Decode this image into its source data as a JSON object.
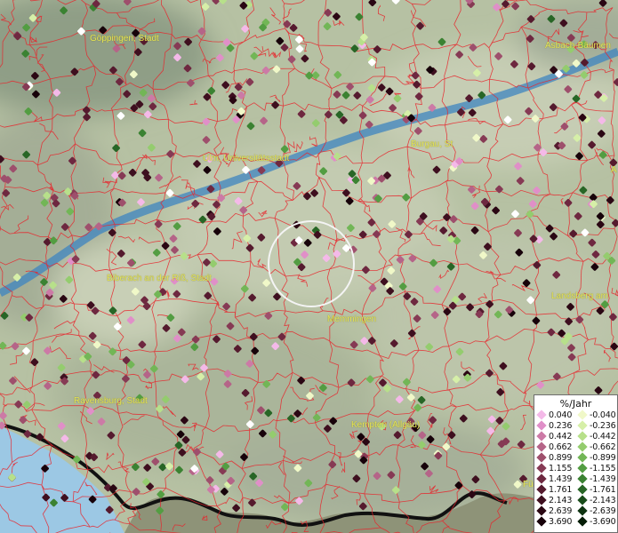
{
  "map": {
    "labels": {
      "goeppingen": "Göppingen, Stadt",
      "asbach": "Asbach-Bäumen",
      "ulm": "Ulm, Universitätsstadt",
      "burgau": "Burgau, St",
      "a_edge": "A",
      "biberach": "Biberach an der Riß, Stadt",
      "memmingen": "Memmingen",
      "landsberg": "Landsberg am",
      "ravensburg": "Ravensburg, Stadt",
      "kempten": "Kempten (Allgäu)",
      "fu_edge": "Fü"
    }
  },
  "legend": {
    "title": "%/Jahr",
    "positive": [
      {
        "label": "0.040",
        "color": "#f4b9e8"
      },
      {
        "label": "0.236",
        "color": "#e08fc8"
      },
      {
        "label": "0.442",
        "color": "#cc7aa6"
      },
      {
        "label": "0.662",
        "color": "#b56488"
      },
      {
        "label": "0.899",
        "color": "#9e4f6c"
      },
      {
        "label": "1.155",
        "color": "#863a54"
      },
      {
        "label": "1.439",
        "color": "#6e2840"
      },
      {
        "label": "1.761",
        "color": "#551a2e"
      },
      {
        "label": "2.143",
        "color": "#3e0f1f"
      },
      {
        "label": "2.639",
        "color": "#2a0713"
      },
      {
        "label": "3.690",
        "color": "#17020a"
      }
    ],
    "negative": [
      {
        "label": "-0.040",
        "color": "#f0f8c8"
      },
      {
        "label": "-0.236",
        "color": "#d6efa8"
      },
      {
        "label": "-0.442",
        "color": "#b7e08a"
      },
      {
        "label": "-0.662",
        "color": "#94cc6e"
      },
      {
        "label": "-0.899",
        "color": "#72b656"
      },
      {
        "label": "-1.155",
        "color": "#539d42"
      },
      {
        "label": "-1.439",
        "color": "#3b8232"
      },
      {
        "label": "-1.761",
        "color": "#286626"
      },
      {
        "label": "-2.143",
        "color": "#194c1a"
      },
      {
        "label": "-2.639",
        "color": "#0d3310"
      },
      {
        "label": "-3.690",
        "color": "#041c06"
      }
    ]
  },
  "colors": {
    "river": "#3e84c0",
    "lake": "#9cc8e4",
    "border": "#e8242c",
    "terrain": "#b5c0a2",
    "label": "#e6e65a"
  }
}
